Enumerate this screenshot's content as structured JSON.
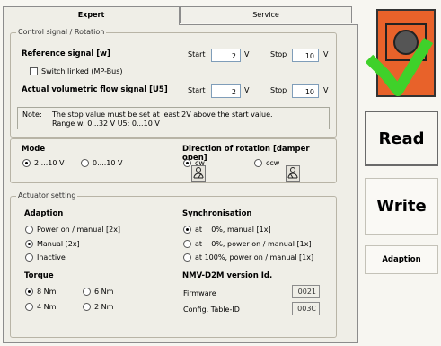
{
  "tabs": {
    "expert": "Expert",
    "service": "Service"
  },
  "control_signal": {
    "group_title": "Control signal / Rotation",
    "reference_label": "Reference signal [w]",
    "start_label": "Start",
    "stop_label": "Stop",
    "ref_start": "2",
    "ref_stop": "10",
    "unit_v": "V",
    "switch_linked_label": "Switch linked (MP-Bus)",
    "switch_linked_checked": false,
    "actual_label": "Actual volumetric flow signal [U5]",
    "act_start": "2",
    "act_stop": "10",
    "note_label": "Note:",
    "note_line1": "The stop value must be set at least 2V above the start value.",
    "note_line2": "Range  w:  0...32 V    U5:  0...10 V"
  },
  "mode": {
    "title": "Mode",
    "options": [
      "2....10 V",
      "0....10 V"
    ],
    "selected": 0
  },
  "direction": {
    "title": "Direction of rotation [damper open]",
    "options": [
      "cw",
      "ccw"
    ],
    "selected": 0
  },
  "actuator": {
    "group_title": "Actuator setting",
    "adaption_title": "Adaption",
    "adaption_options": [
      "Power on / manual [2x]",
      "Manual [2x]",
      "Inactive"
    ],
    "adaption_selected": 1,
    "sync_title": "Synchronisation",
    "sync_options": [
      "at    0%, manual [1x]",
      "at    0%, power on / manual [1x]",
      "at 100%, power on / manual [1x]"
    ],
    "sync_selected": 0,
    "torque_title": "Torque",
    "torque_options": [
      "8 Nm",
      "6 Nm",
      "4 Nm",
      "2 Nm"
    ],
    "torque_selected": 0,
    "version_title": "NMV-D2M version Id.",
    "firmware_label": "Firmware",
    "firmware_value": "0021",
    "config_label": "Config. Table-ID",
    "config_value": "003C"
  },
  "side": {
    "read_label": "Read",
    "write_label": "Write",
    "adaption_label": "Adaption"
  },
  "colors": {
    "device_orange": "#e8622a",
    "check_green": "#3fd12a"
  }
}
